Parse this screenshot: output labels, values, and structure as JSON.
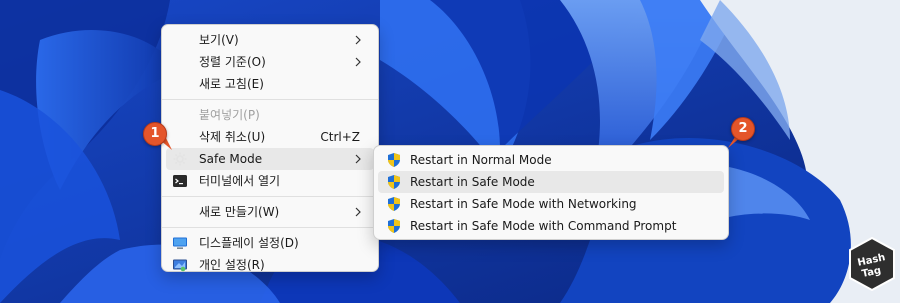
{
  "main_menu": {
    "items": [
      {
        "label": "보기(V)",
        "has_submenu": true
      },
      {
        "label": "정렬 기준(O)",
        "has_submenu": true
      },
      {
        "label": "새로 고침(E)"
      },
      {
        "label": "붙여넣기(P)",
        "disabled": true
      },
      {
        "label": "삭제 취소(U)",
        "shortcut": "Ctrl+Z"
      },
      {
        "label": "Safe Mode",
        "has_submenu": true,
        "icon": "gear-icon",
        "highlighted": true
      },
      {
        "label": "터미널에서 열기",
        "icon": "terminal-icon"
      },
      {
        "label": "새로 만들기(W)",
        "has_submenu": true
      },
      {
        "label": "디스플레이 설정(D)",
        "icon": "display-icon"
      },
      {
        "label": "개인 설정(R)",
        "icon": "personalize-icon"
      }
    ]
  },
  "sub_menu": {
    "items": [
      {
        "label": "Restart in Normal Mode",
        "icon": "uac-shield-icon"
      },
      {
        "label": "Restart in Safe Mode",
        "icon": "uac-shield-icon",
        "highlighted": true
      },
      {
        "label": "Restart in Safe Mode with Networking",
        "icon": "uac-shield-icon"
      },
      {
        "label": "Restart in Safe Mode with Command Prompt",
        "icon": "uac-shield-icon"
      }
    ]
  },
  "annotations": {
    "badge_1": "1",
    "badge_2": "2",
    "color": "#e4552a"
  },
  "logo": {
    "line1": "Hash",
    "line2": "Tag"
  },
  "colors": {
    "wallpaper_blue": "#1c4fd0",
    "menu_bg": "#f9f9f9",
    "highlight": "#e8e8e8"
  }
}
